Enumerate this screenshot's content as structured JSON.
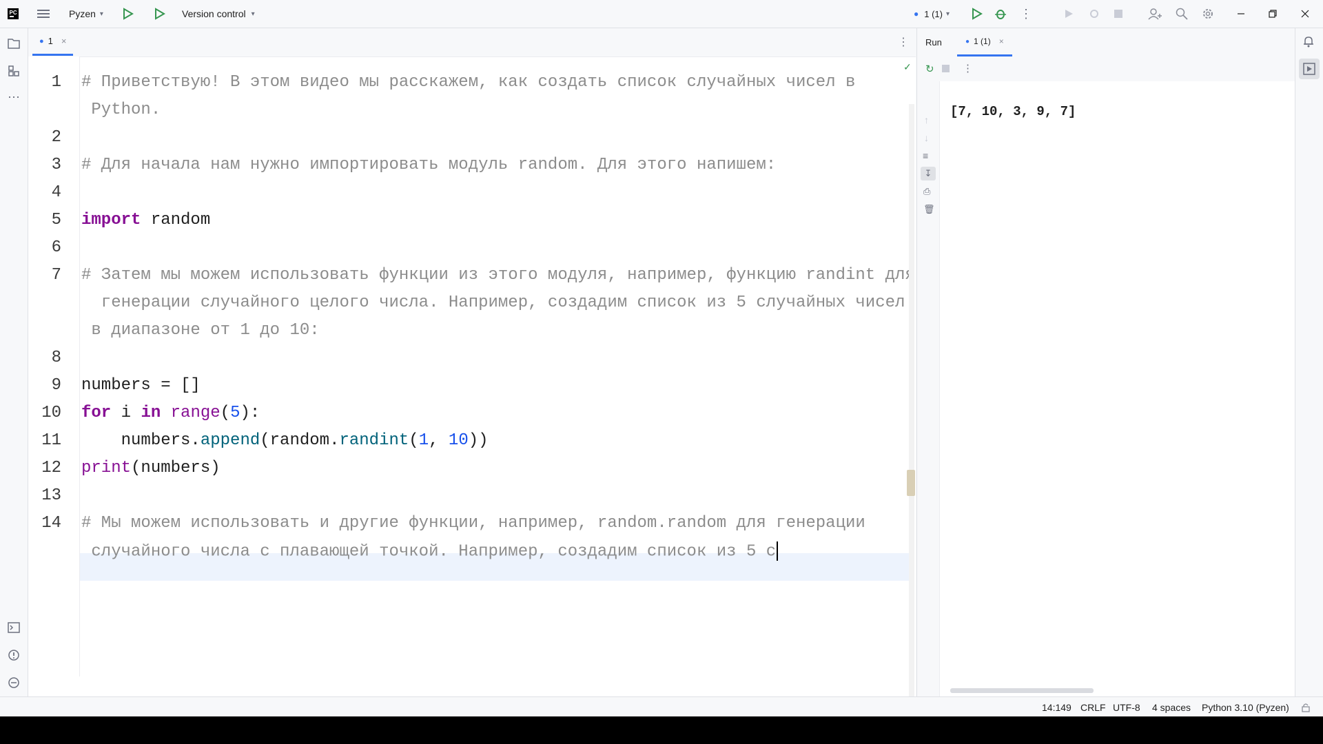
{
  "titlebar": {
    "project_name": "Pyzen",
    "version_control": "Version control",
    "run_config": "1 (1)"
  },
  "editor": {
    "tab_label": "1",
    "lines": [
      {
        "no": "1",
        "segments": [
          {
            "t": "# Приветствую! В этом видео мы расскажем, как создать список случайных чисел в",
            "c": "cmt"
          }
        ]
      },
      {
        "no": "",
        "segments": [
          {
            "t": " Python.",
            "c": "cmt"
          }
        ]
      },
      {
        "no": "2",
        "segments": []
      },
      {
        "no": "3",
        "segments": [
          {
            "t": "# Для начала нам нужно импортировать модуль random. Для этого напишем:",
            "c": "cmt"
          }
        ]
      },
      {
        "no": "4",
        "segments": []
      },
      {
        "no": "5",
        "segments": [
          {
            "t": "import",
            "c": "kw"
          },
          {
            "t": " random",
            "c": "txt"
          }
        ]
      },
      {
        "no": "6",
        "segments": []
      },
      {
        "no": "7",
        "segments": [
          {
            "t": "# Затем мы можем использовать функции из этого модуля, например, функцию randint для",
            "c": "cmt"
          }
        ]
      },
      {
        "no": "",
        "segments": [
          {
            "t": "  генерации случайного целого числа. Например, создадим список из 5 случайных чисел",
            "c": "cmt"
          }
        ]
      },
      {
        "no": "",
        "segments": [
          {
            "t": " в диапазоне от 1 до 10:",
            "c": "cmt"
          }
        ]
      },
      {
        "no": "8",
        "segments": []
      },
      {
        "no": "9",
        "segments": [
          {
            "t": "numbers = []",
            "c": "txt"
          }
        ]
      },
      {
        "no": "10",
        "segments": [
          {
            "t": "for",
            "c": "kw"
          },
          {
            "t": " i ",
            "c": "txt"
          },
          {
            "t": "in",
            "c": "kw"
          },
          {
            "t": " ",
            "c": "txt"
          },
          {
            "t": "range",
            "c": "bi"
          },
          {
            "t": "(",
            "c": "txt"
          },
          {
            "t": "5",
            "c": "num"
          },
          {
            "t": "):",
            "c": "txt"
          }
        ]
      },
      {
        "no": "11",
        "segments": [
          {
            "t": "    numbers.",
            "c": "txt"
          },
          {
            "t": "append",
            "c": "fn"
          },
          {
            "t": "(random.",
            "c": "txt"
          },
          {
            "t": "randint",
            "c": "fn"
          },
          {
            "t": "(",
            "c": "txt"
          },
          {
            "t": "1",
            "c": "num"
          },
          {
            "t": ", ",
            "c": "txt"
          },
          {
            "t": "10",
            "c": "num"
          },
          {
            "t": "))",
            "c": "txt"
          }
        ]
      },
      {
        "no": "12",
        "segments": [
          {
            "t": "print",
            "c": "bi"
          },
          {
            "t": "(numbers)",
            "c": "txt"
          }
        ]
      },
      {
        "no": "13",
        "segments": []
      },
      {
        "no": "14",
        "segments": [
          {
            "t": "# Мы можем использовать и другие функции, например, random.random для генерации",
            "c": "cmt"
          }
        ]
      },
      {
        "no": "",
        "segments": [
          {
            "t": " случайного числа с плавающей точкой. Например, создадим список из 5 с",
            "c": "cmt"
          }
        ]
      }
    ]
  },
  "run": {
    "tab_run": "Run",
    "tab_config": "1 (1)",
    "output": "[7, 10, 3, 9, 7]"
  },
  "status": {
    "position": "14:149",
    "line_sep": "CRLF",
    "encoding": "UTF-8",
    "indent": "4 spaces",
    "interpreter": "Python 3.10 (Pyzen)"
  },
  "colors": {
    "accent": "#3574f0",
    "run_green": "#369650",
    "keyword": "#871094",
    "comment": "#8c8c8c",
    "number": "#1750eb"
  }
}
